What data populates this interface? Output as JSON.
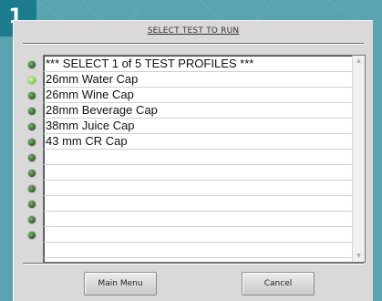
{
  "step_badge": "1",
  "dialog": {
    "title": "SELECT TEST TO RUN"
  },
  "list": {
    "items": [
      "*** SELECT 1 of 5 TEST PROFILES ***",
      "26mm Water Cap",
      "26mm Wine Cap",
      "28mm Beverage Cap",
      "38mm Juice Cap",
      "43 mm CR Cap",
      "",
      "",
      "",
      "",
      "",
      "",
      ""
    ],
    "active_indicator_index": 1,
    "indicator_count": 9
  },
  "buttons": {
    "main_menu": "Main Menu",
    "cancel": "Cancel"
  },
  "colors": {
    "background_teal": "#5aa3b0",
    "badge_teal": "#1a7c8c",
    "panel_gray": "#d9d9d9",
    "indicator_green": "#3e6d36",
    "indicator_active": "#92d84b"
  }
}
